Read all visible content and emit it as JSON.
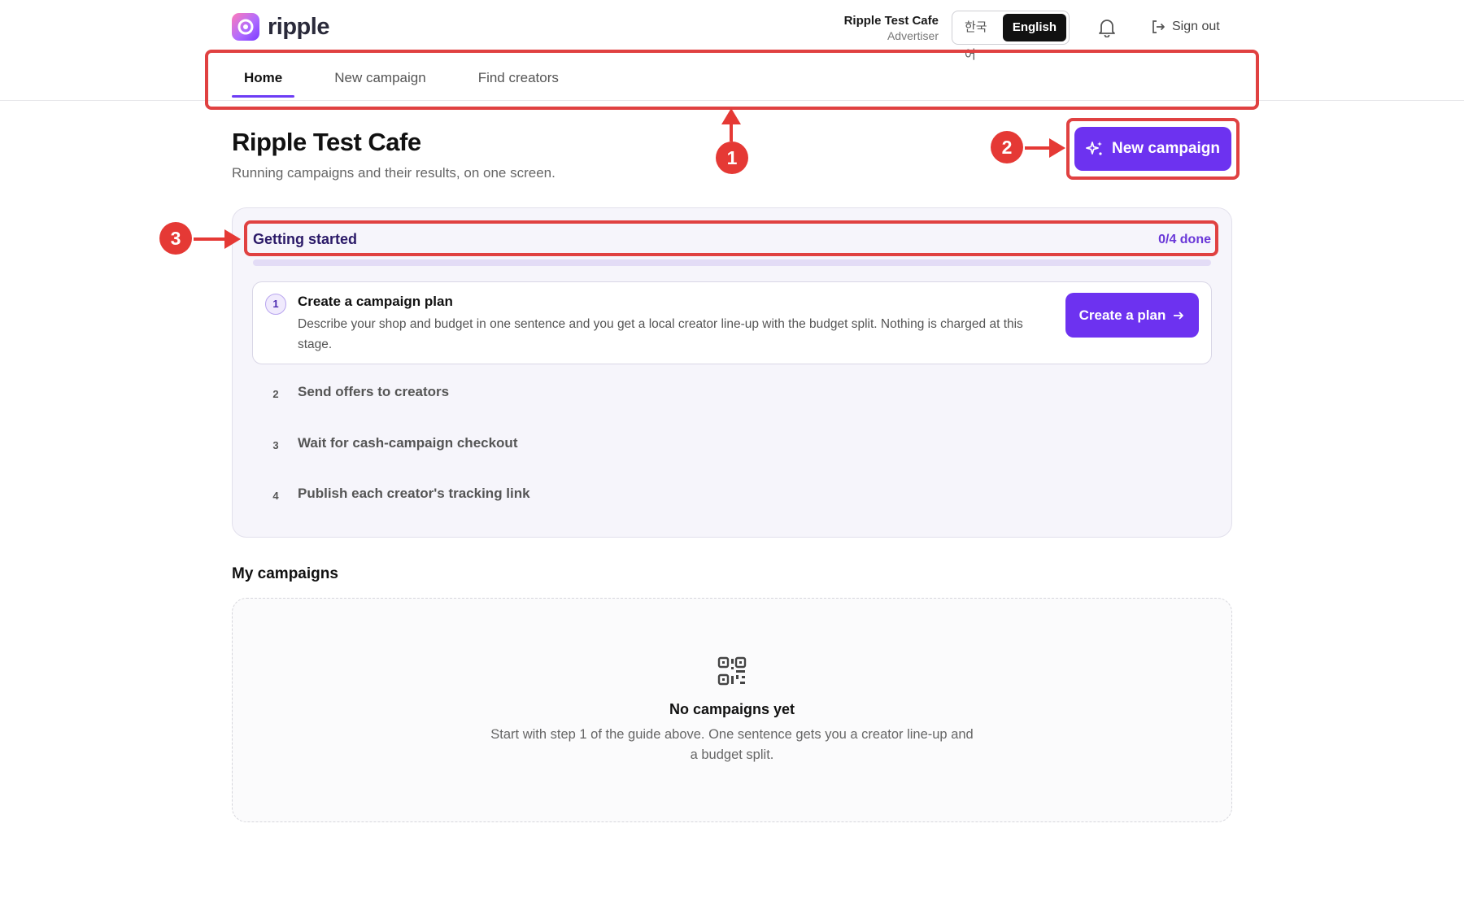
{
  "header": {
    "logo_text": "ripple",
    "account_name": "Ripple Test Cafe",
    "account_role": "Advertiser",
    "languages": [
      "한국어",
      "English"
    ],
    "active_language": "English",
    "signout_label": "Sign out"
  },
  "nav": {
    "tabs": [
      {
        "label": "Home",
        "active": true
      },
      {
        "label": "New campaign",
        "active": false
      },
      {
        "label": "Find creators",
        "active": false
      }
    ]
  },
  "page": {
    "title": "Ripple Test Cafe",
    "subtitle": "Running campaigns and their results, on one screen.",
    "new_campaign_label": "New campaign"
  },
  "getting_started": {
    "title": "Getting started",
    "count": "0/4 done",
    "progress": 0,
    "steps": [
      {
        "number": "1",
        "title": "Create a campaign plan",
        "description": "Describe your shop and budget in one sentence and you get a local creator line-up with the budget split. Nothing is charged at this stage.",
        "button_label": "Create a plan"
      },
      {
        "number": "2",
        "title": "Send offers to creators"
      },
      {
        "number": "3",
        "title": "Wait for cash-campaign checkout"
      },
      {
        "number": "4",
        "title": "Publish each creator's tracking link"
      }
    ]
  },
  "my_campaigns": {
    "title": "My campaigns",
    "empty_title": "No campaigns yet",
    "empty_description": "Start with step 1 of the guide above. One sentence gets you a creator line-up and a budget split."
  },
  "annotations": [
    "1",
    "2",
    "3"
  ],
  "colors": {
    "accent": "#6d32f0",
    "annotation": "#e53935"
  }
}
